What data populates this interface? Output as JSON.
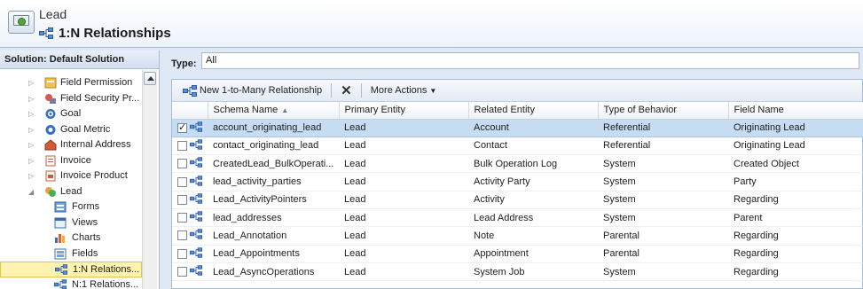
{
  "header": {
    "entity": "Lead",
    "title": "1:N Relationships"
  },
  "leftnav": {
    "heading": "Solution: Default Solution",
    "items": [
      {
        "label": "Field Permission",
        "icon": "field-permission-icon",
        "level": 1
      },
      {
        "label": "Field Security Pr...",
        "icon": "field-security-icon",
        "level": 1
      },
      {
        "label": "Goal",
        "icon": "goal-icon",
        "level": 1
      },
      {
        "label": "Goal Metric",
        "icon": "goal-metric-icon",
        "level": 1
      },
      {
        "label": "Internal Address",
        "icon": "internal-address-icon",
        "level": 1
      },
      {
        "label": "Invoice",
        "icon": "invoice-icon",
        "level": 1
      },
      {
        "label": "Invoice Product",
        "icon": "invoice-product-icon",
        "level": 1
      },
      {
        "label": "Lead",
        "icon": "lead-icon",
        "level": 1,
        "expanded": true
      },
      {
        "label": "Forms",
        "icon": "forms-icon",
        "level": 2
      },
      {
        "label": "Views",
        "icon": "views-icon",
        "level": 2
      },
      {
        "label": "Charts",
        "icon": "charts-icon",
        "level": 2
      },
      {
        "label": "Fields",
        "icon": "fields-icon",
        "level": 2
      },
      {
        "label": "1:N Relations...",
        "icon": "relationship-icon",
        "level": 2,
        "selected": true
      },
      {
        "label": "N:1 Relations...",
        "icon": "relationship-icon",
        "level": 2
      }
    ]
  },
  "filter": {
    "label": "Type:",
    "value": "All"
  },
  "toolbar": {
    "new_label": "New 1-to-Many Relationship",
    "more_label": "More Actions"
  },
  "grid": {
    "columns": [
      "Schema Name",
      "Primary Entity",
      "Related Entity",
      "Type of Behavior",
      "Field Name"
    ],
    "rows": [
      [
        "account_originating_lead",
        "Lead",
        "Account",
        "Referential",
        "Originating Lead"
      ],
      [
        "contact_originating_lead",
        "Lead",
        "Contact",
        "Referential",
        "Originating Lead"
      ],
      [
        "CreatedLead_BulkOperati...",
        "Lead",
        "Bulk Operation Log",
        "System",
        "Created Object"
      ],
      [
        "lead_activity_parties",
        "Lead",
        "Activity Party",
        "System",
        "Party"
      ],
      [
        "Lead_ActivityPointers",
        "Lead",
        "Activity",
        "System",
        "Regarding"
      ],
      [
        "lead_addresses",
        "Lead",
        "Lead Address",
        "System",
        "Parent"
      ],
      [
        "Lead_Annotation",
        "Lead",
        "Note",
        "Parental",
        "Regarding"
      ],
      [
        "Lead_Appointments",
        "Lead",
        "Appointment",
        "Parental",
        "Regarding"
      ],
      [
        "Lead_AsyncOperations",
        "Lead",
        "System Job",
        "System",
        "Regarding"
      ]
    ],
    "selected_row": 0
  },
  "colors": {
    "selection": "#c6dcf3",
    "nav_selected": "#fff3b0",
    "border": "#a6bcd8"
  }
}
